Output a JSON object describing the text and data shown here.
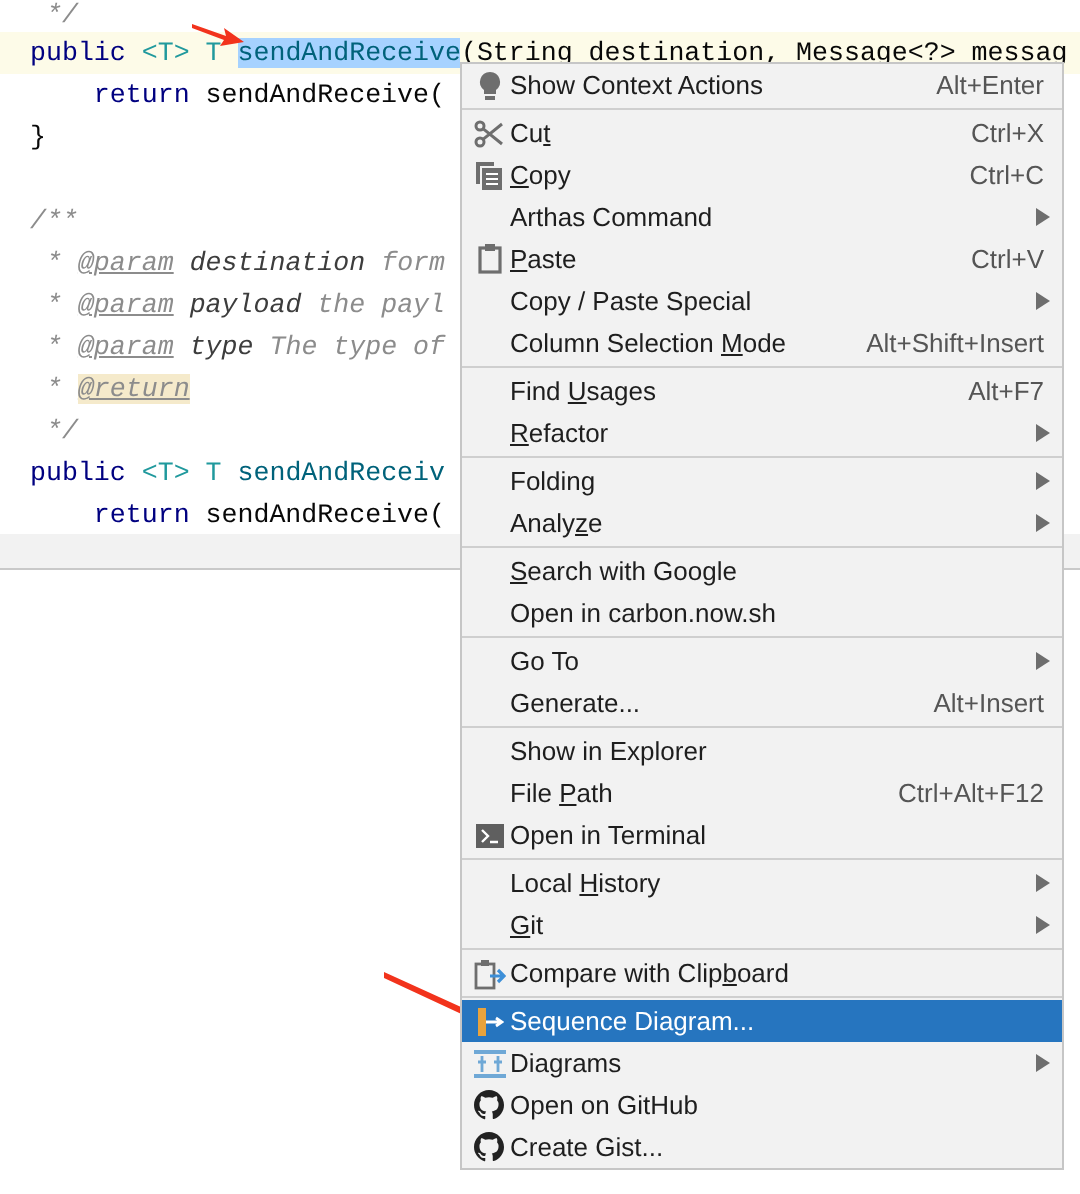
{
  "editor": {
    "lines": [
      {
        "current": false,
        "tokens": [
          {
            "text": " */",
            "kind": "comment"
          }
        ]
      },
      {
        "current": true,
        "tokens": [
          {
            "text": "public ",
            "kind": "keyword"
          },
          {
            "text": "<T> T ",
            "kind": "type"
          },
          {
            "text": "sendAndReceive",
            "kind": "selected"
          },
          {
            "text": "(String destination, Message<?> messag",
            "kind": "plain"
          }
        ]
      },
      {
        "current": false,
        "tokens": [
          {
            "text": "    return ",
            "kind": "keyword"
          },
          {
            "text": "sendAndReceive(",
            "kind": "plain"
          }
        ]
      },
      {
        "current": false,
        "tokens": [
          {
            "text": "}",
            "kind": "plain"
          }
        ]
      },
      {
        "current": false
      },
      {
        "current": false,
        "tokens": [
          {
            "text": "/**",
            "kind": "comment"
          }
        ]
      },
      {
        "current": false,
        "tokens": [
          {
            "text": " * ",
            "kind": "comment"
          },
          {
            "text": "@param",
            "kind": "tag"
          },
          {
            "text": " destination",
            "kind": "param"
          },
          {
            "text": " form",
            "kind": "comment"
          }
        ]
      },
      {
        "current": false,
        "tokens": [
          {
            "text": " * ",
            "kind": "comment"
          },
          {
            "text": "@param",
            "kind": "tag"
          },
          {
            "text": " payload",
            "kind": "param"
          },
          {
            "text": " the payl",
            "kind": "comment"
          }
        ]
      },
      {
        "current": false,
        "tokens": [
          {
            "text": " * ",
            "kind": "comment"
          },
          {
            "text": "@param",
            "kind": "tag"
          },
          {
            "text": " type",
            "kind": "param"
          },
          {
            "text": " The type of",
            "kind": "comment"
          }
        ]
      },
      {
        "current": false,
        "tokens": [
          {
            "text": " * ",
            "kind": "comment"
          },
          {
            "text": "@return",
            "kind": "marked"
          }
        ]
      },
      {
        "current": false,
        "tokens": [
          {
            "text": " */",
            "kind": "comment"
          }
        ]
      },
      {
        "current": false,
        "tokens": [
          {
            "text": "public ",
            "kind": "keyword"
          },
          {
            "text": "<T> T ",
            "kind": "type"
          },
          {
            "text": "sendAndReceiv",
            "kind": "method"
          }
        ]
      },
      {
        "current": false,
        "tokens": [
          {
            "text": "    return ",
            "kind": "keyword"
          },
          {
            "text": "sendAndReceive(",
            "kind": "plain"
          }
        ]
      }
    ]
  },
  "context_menu": {
    "groups": [
      {
        "items": [
          {
            "label": "Show Context Actions",
            "shortcut": "Alt+Enter",
            "kind": "bulb",
            "submenu": false,
            "selected": false
          }
        ]
      },
      {
        "items": [
          {
            "label": "Cu",
            "mnemonic": "t",
            "shortcut": "Ctrl+X",
            "kind": "scissors",
            "submenu": false,
            "selected": false
          },
          {
            "mnemonic": "C",
            "label_after": "opy",
            "shortcut": "Ctrl+C",
            "kind": "copy",
            "submenu": false,
            "selected": false
          },
          {
            "label": "Arthas Command",
            "submenu": true,
            "selected": false
          },
          {
            "mnemonic": "P",
            "label_after": "aste",
            "shortcut": "Ctrl+V",
            "kind": "paste",
            "submenu": false,
            "selected": false
          },
          {
            "label": "Copy / Paste Special",
            "submenu": true,
            "selected": false
          },
          {
            "label": "Column Selection ",
            "mnemonic": "M",
            "label_after": "ode",
            "shortcut": "Alt+Shift+Insert",
            "submenu": false,
            "selected": false
          }
        ]
      },
      {
        "items": [
          {
            "label": "Find ",
            "mnemonic": "U",
            "label_after": "sages",
            "shortcut": "Alt+F7",
            "submenu": false,
            "selected": false
          },
          {
            "mnemonic": "R",
            "label_after": "efactor",
            "submenu": true,
            "selected": false
          }
        ]
      },
      {
        "items": [
          {
            "label": "Folding",
            "submenu": true,
            "selected": false
          },
          {
            "label": "Analy",
            "mnemonic": "z",
            "label_after": "e",
            "submenu": true,
            "selected": false
          }
        ]
      },
      {
        "items": [
          {
            "mnemonic": "S",
            "label_after": "earch with Google",
            "submenu": false,
            "selected": false
          },
          {
            "label": "Open in carbon.now.sh",
            "submenu": false,
            "selected": false
          }
        ]
      },
      {
        "items": [
          {
            "label": "Go To",
            "submenu": true,
            "selected": false
          },
          {
            "label": "Generate...",
            "shortcut": "Alt+Insert",
            "submenu": false,
            "selected": false
          }
        ]
      },
      {
        "items": [
          {
            "label": "Show in Explorer",
            "submenu": false,
            "selected": false
          },
          {
            "label": "File ",
            "mnemonic": "P",
            "label_after": "ath",
            "shortcut": "Ctrl+Alt+F12",
            "submenu": false,
            "selected": false
          },
          {
            "label": "Open in Terminal",
            "kind": "terminal",
            "submenu": false,
            "selected": false
          }
        ]
      },
      {
        "items": [
          {
            "label": "Local ",
            "mnemonic": "H",
            "label_after": "istory",
            "submenu": true,
            "selected": false
          },
          {
            "mnemonic": "G",
            "label_after": "it",
            "submenu": true,
            "selected": false
          }
        ]
      },
      {
        "items": [
          {
            "label": "Compare with Clip",
            "mnemonic": "b",
            "label_after": "oard",
            "kind": "compare",
            "submenu": false,
            "selected": false
          }
        ]
      },
      {
        "items": [
          {
            "label": "Sequence Diagram...",
            "kind": "sequence",
            "submenu": false,
            "selected": true
          },
          {
            "label": "Diagrams",
            "kind": "diagrams",
            "submenu": true,
            "selected": false
          },
          {
            "label": "Open on GitHub",
            "kind": "github",
            "submenu": false,
            "selected": false
          },
          {
            "label": "Create Gist...",
            "kind": "github",
            "submenu": false,
            "selected": false
          }
        ]
      }
    ]
  }
}
